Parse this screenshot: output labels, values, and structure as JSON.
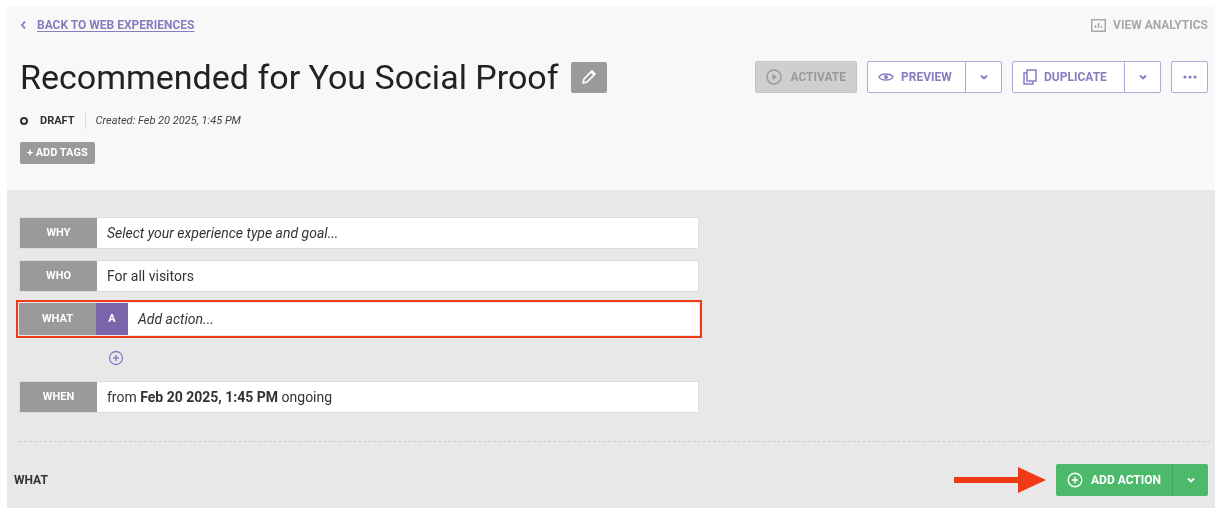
{
  "back_link": "BACK TO WEB EXPERIENCES",
  "view_analytics": {
    "label": "VIEW ANALYTICS",
    "disabled": true
  },
  "title": "Recommended for You Social Proof",
  "toolbar": {
    "activate": {
      "label": "ACTIVATE",
      "disabled": true
    },
    "preview": "PREVIEW",
    "duplicate": "DUPLICATE"
  },
  "status": {
    "label": "DRAFT",
    "created": "Created: Feb 20 2025, 1:45 PM"
  },
  "add_tags": "+ ADD TAGS",
  "rows": [
    {
      "label": "WHY",
      "kind": "placeholder",
      "text": "Select your experience type and goal...",
      "highlighted": false
    },
    {
      "label": "WHO",
      "kind": "text",
      "text": "For all visitors",
      "highlighted": false
    },
    {
      "label": "WHAT",
      "kind": "action",
      "badge": "A",
      "text": "Add action...",
      "highlighted": true
    },
    {
      "label": "WHEN",
      "kind": "text",
      "text": "from **Feb 20 2025, 1:45 PM** ongoing",
      "highlighted": false
    }
  ],
  "footer": {
    "section_label": "WHAT",
    "add_action": "ADD ACTION",
    "arrow_pointer": true
  }
}
